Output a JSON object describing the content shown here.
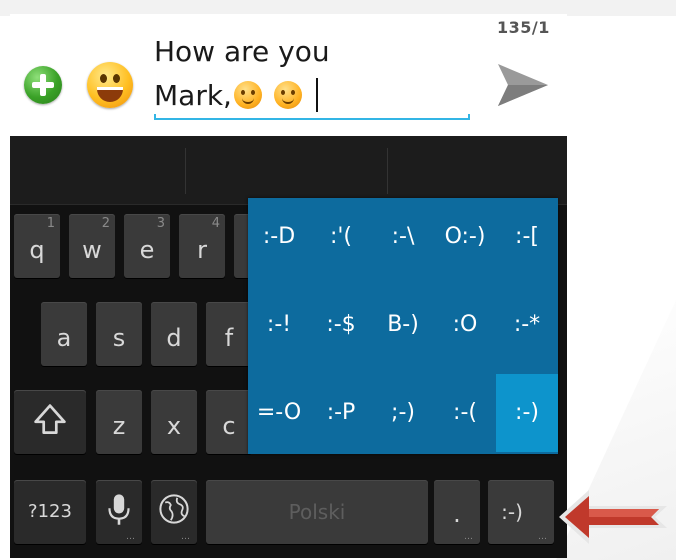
{
  "compose": {
    "char_counter": "135/1",
    "message_line1": "How are you",
    "message_line2": "Mark,"
  },
  "keyboard": {
    "row1": [
      {
        "label": "q",
        "hint": "1"
      },
      {
        "label": "w",
        "hint": "2"
      },
      {
        "label": "e",
        "hint": "3"
      },
      {
        "label": "r",
        "hint": "4"
      }
    ],
    "row2": [
      "a",
      "s",
      "d",
      "f"
    ],
    "row3": [
      "z",
      "x",
      "c"
    ],
    "numbers_key": "?123",
    "space_label": "Polski",
    "period_key": ".",
    "smiley_key": ":-)"
  },
  "emoticon_popup": {
    "rows": [
      [
        ":-D",
        ":'(",
        ":-\\",
        "O:-)",
        ":-["
      ],
      [
        ":-!",
        ":-$",
        "B-)",
        ":O",
        ":-*"
      ],
      [
        "=-O",
        ":-P",
        ";-)",
        ":-(",
        ":-)"
      ]
    ],
    "selected": ":-)"
  },
  "colors": {
    "accent": "#33b5e5",
    "popup_bg": "#0d6b9e",
    "popup_selected": "#0d94cc",
    "annotation_arrow": "#c0392b"
  },
  "icons": [
    "add-attachment-icon",
    "smiley-picker-icon",
    "send-icon",
    "shift-icon",
    "microphone-icon",
    "globe-icon",
    "pointer-arrow-icon"
  ]
}
